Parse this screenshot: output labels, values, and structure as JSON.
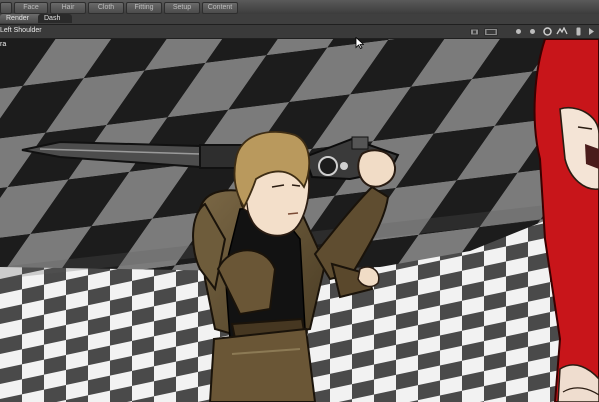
{
  "topbar": {
    "tabs": [
      {
        "label": "",
        "icon": "tab-blank"
      },
      {
        "label": "Face"
      },
      {
        "label": "Hair"
      },
      {
        "label": "Cloth"
      },
      {
        "label": "Fitting"
      },
      {
        "label": "Setup"
      },
      {
        "label": "Content"
      }
    ]
  },
  "subbar": {
    "tabs": [
      {
        "label": "Render"
      },
      {
        "label": "Dash"
      }
    ]
  },
  "header": {
    "selection_label": "Left Shoulder",
    "controls": [
      "camera-icon",
      "frame-icon",
      "dot-icon",
      "dot-icon",
      "circle-icon",
      "pose-icon",
      "wire-icon",
      "more-icon"
    ]
  },
  "viewport": {
    "camera_label": "ra"
  },
  "colors": {
    "floor_dark": "#1c1c1c",
    "floor_light": "#8a8a8a",
    "armor": "#6b5a3a",
    "shirt": "#101010",
    "hair_blond": "#b9995d",
    "hair_red": "#c8151a",
    "skin": "#efd6be",
    "blade": "#4a4a4a"
  }
}
